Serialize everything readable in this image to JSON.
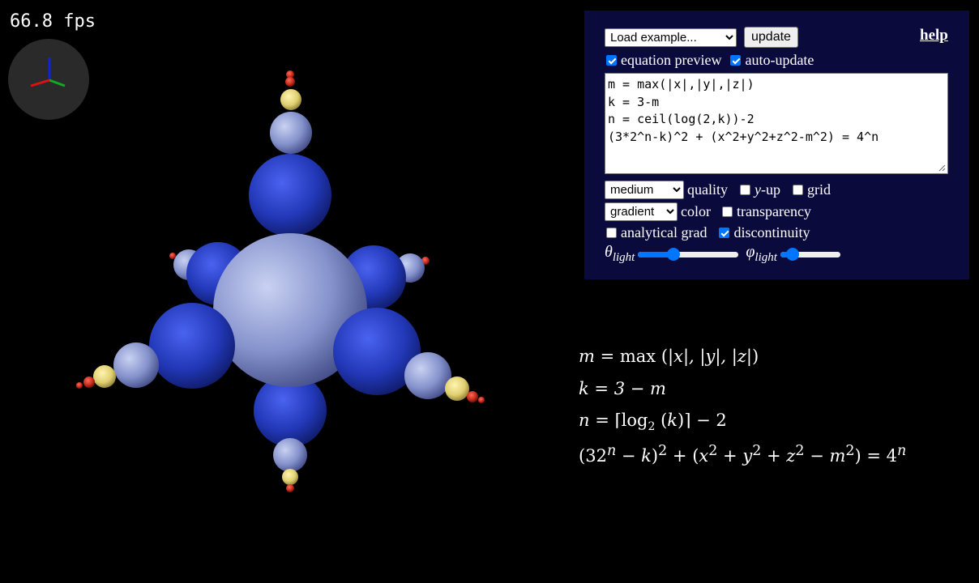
{
  "fps": "66.8 fps",
  "axes_colors": {
    "x": "#dd1111",
    "y": "#11aa22",
    "z": "#1122dd",
    "bg": "#2a2a2a"
  },
  "panel": {
    "example_select": "Load example...",
    "update_button": "update",
    "help_link": "help",
    "equation_preview": {
      "label": "equation preview",
      "checked": true
    },
    "auto_update": {
      "label": "auto-update",
      "checked": true
    },
    "code_lines": [
      "m = max(|x|,|y|,|z|)",
      "k = 3-m",
      "n = ceil(log(2,k))-2",
      "(3*2^n-k)^2 + (x^2+y^2+z^2-m^2) = 4^n"
    ],
    "quality_select": "medium",
    "quality_label": "quality",
    "y_up": {
      "label_var": "y",
      "label_rest": "-up",
      "checked": false
    },
    "grid": {
      "label": "grid",
      "checked": false
    },
    "color_select": "gradient",
    "color_label": "color",
    "transparency": {
      "label": "transparency",
      "checked": false
    },
    "analytical_grad": {
      "label": "analytical grad",
      "checked": false
    },
    "discontinuity": {
      "label": "discontinuity",
      "checked": true
    },
    "theta_light": {
      "sym": "θ",
      "sub": "light",
      "value": 0.35
    },
    "phi_light": {
      "sym": "φ",
      "sub": "light",
      "value": 0.2
    },
    "accent_color": "#0075ff",
    "panel_bg": "#0a0a3c"
  },
  "math": {
    "line1": {
      "lhs": "m",
      "fn": "max",
      "args": "|x|, |y|, |z|"
    },
    "line2": {
      "lhs": "k",
      "rhs": "3 − m"
    },
    "line3": {
      "lhs": "n",
      "fn": "log",
      "base": "2",
      "arg": "k",
      "tail": "− 2"
    },
    "line4": {
      "a": "32",
      "n": "n",
      "k": "k",
      "terms": "x",
      "y": "y",
      "z": "z",
      "m": "m",
      "rhs": "4",
      "exp": "n"
    }
  }
}
